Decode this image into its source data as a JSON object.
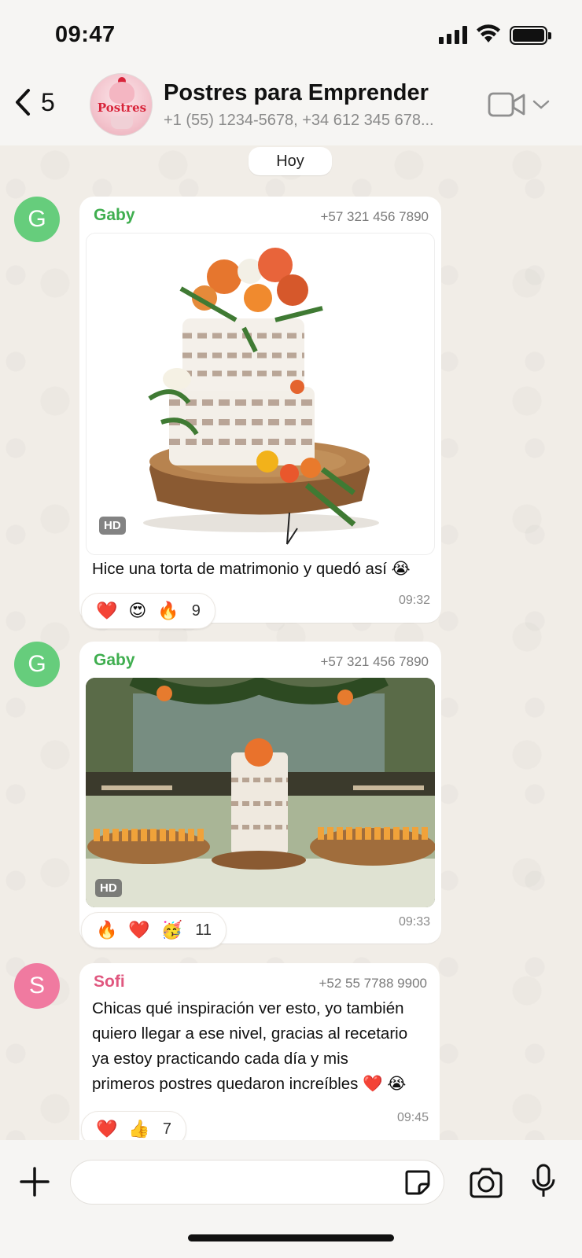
{
  "status_bar": {
    "time": "09:47"
  },
  "header": {
    "back_count": "5",
    "group_name": "Postres para Emprender",
    "members": "+1 (55) 1234-5678, +34 612 345 678...",
    "avatar_text": "Postres"
  },
  "date_divider": "Hoy",
  "messages": [
    {
      "avatar_letter": "G",
      "sender": "Gaby",
      "phone": "+57 321 456 7890",
      "hd": "HD",
      "caption": "Hice una torta de matrimonio y quedó así 😭",
      "reactions": [
        "❤️",
        "😍",
        "🔥"
      ],
      "reaction_count": "9",
      "time": "09:32"
    },
    {
      "avatar_letter": "G",
      "sender": "Gaby",
      "phone": "+57 321 456 7890",
      "hd": "HD",
      "reactions": [
        "🔥",
        "❤️",
        "🥳"
      ],
      "reaction_count": "11",
      "time": "09:33"
    },
    {
      "avatar_letter": "S",
      "sender": "Sofi",
      "phone": "+52 55 7788 9900",
      "lines": [
        "Chicas qué inspiración ver esto, yo también",
        "quiero llegar a ese nivel, gracias al recetario",
        "ya estoy practicando cada día y mis",
        "primeros postres quedaron increíbles ❤️ 😭"
      ],
      "reactions": [
        "❤️",
        "👍"
      ],
      "reaction_count": "7",
      "time": "09:45"
    }
  ],
  "colors": {
    "sender_green": "#3fae4f",
    "avatar_green": "#66cd7c",
    "sender_pink": "#e0577f",
    "avatar_pink": "#f07aa0"
  }
}
